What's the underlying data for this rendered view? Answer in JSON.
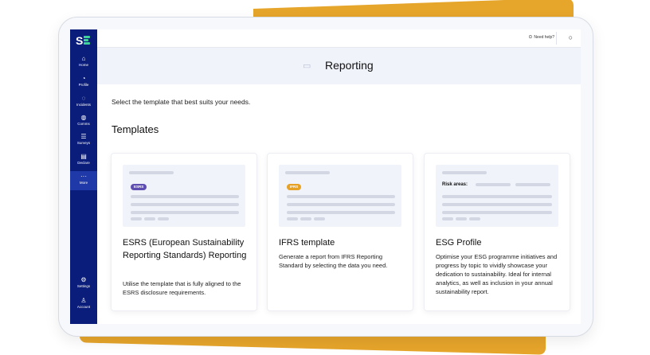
{
  "sidebar": {
    "logo_text": "S",
    "items": [
      {
        "label": "Home",
        "icon": "home-icon",
        "glyph": "⌂"
      },
      {
        "label": "Profile",
        "icon": "profile-icon",
        "glyph": "◔"
      },
      {
        "label": "Incidents",
        "icon": "incidents-icon",
        "glyph": "◌"
      },
      {
        "label": "Comms",
        "icon": "comms-icon",
        "glyph": "◍"
      },
      {
        "label": "Surveys",
        "icon": "surveys-icon",
        "glyph": "☰"
      },
      {
        "label": "Declare",
        "icon": "declare-icon",
        "glyph": "▤"
      },
      {
        "label": "More",
        "icon": "more-icon",
        "glyph": "···"
      }
    ],
    "bottom_items": [
      {
        "label": "Settings",
        "icon": "settings-icon",
        "glyph": "⚙"
      },
      {
        "label": "Account",
        "icon": "account-icon",
        "glyph": "♙"
      }
    ]
  },
  "topbar": {
    "help_label": "Need help?",
    "help_glyph": "⊙",
    "profile_glyph": "○"
  },
  "header": {
    "title": "Reporting",
    "icon": "report-icon",
    "icon_glyph": "▭"
  },
  "main": {
    "subtitle": "Select the template that best suits your needs.",
    "section_title": "Templates"
  },
  "cards": [
    {
      "badge": "ESRS",
      "title": "ESRS (European Sustainability Reporting Standards) Reporting",
      "description": "Utilise the template that is fully aligned to the ESRS disclosure requirements."
    },
    {
      "badge": "IFRS",
      "title": "IFRS template",
      "description": "Generate a report from IFRS Reporting Standard by selecting the data you need."
    },
    {
      "risk_label": "Risk areas:",
      "title": "ESG Profile",
      "description": "Optimise your ESG programme initiatives and progress by topic to vividly showcase your dedication to sustainability. Ideal for internal analytics, as well as inclusion in your annual sustainability report."
    }
  ],
  "colors": {
    "sidebar": "#0a1d7a",
    "accent": "#e6a52b",
    "esrs_badge": "#5e4eb1",
    "ifrs_badge": "#e7a124",
    "logo_green": "#3fd39b"
  }
}
